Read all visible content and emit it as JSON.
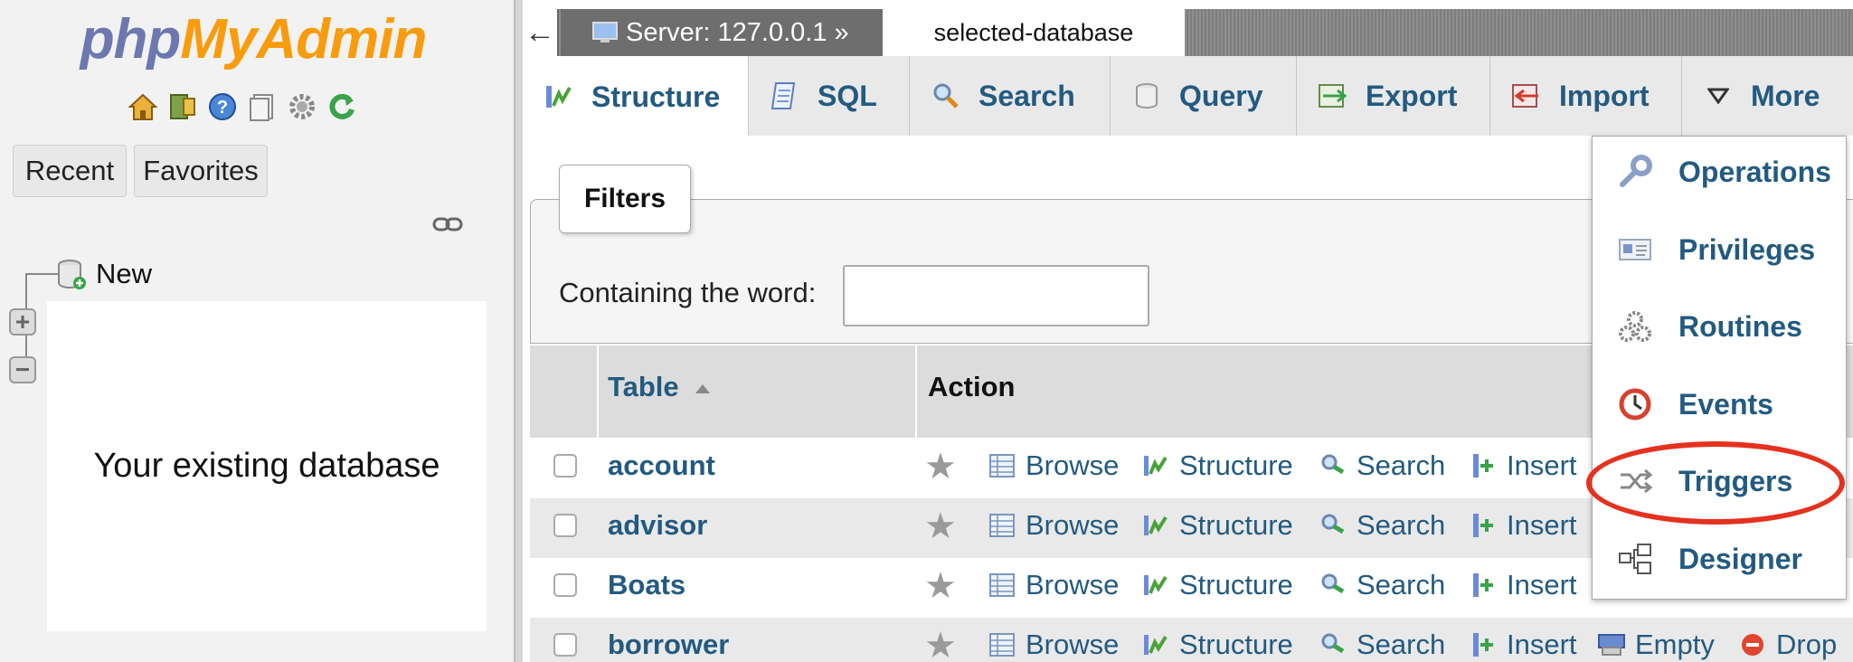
{
  "app": {
    "logo_php": "php",
    "logo_myadmin": "MyAdmin",
    "left_buttons": [
      "Recent",
      "Favorites"
    ],
    "tree_new_label": "New",
    "database_box_text": "Your existing database"
  },
  "breadcrumb": {
    "back": "←",
    "server": "Server: 127.0.0.1 »",
    "database": "selected-database"
  },
  "tabs": [
    {
      "label": "Structure",
      "icon": "structure-icon",
      "active": true
    },
    {
      "label": "SQL",
      "icon": "sql-icon"
    },
    {
      "label": "Search",
      "icon": "search-icon"
    },
    {
      "label": "Query",
      "icon": "query-icon"
    },
    {
      "label": "Export",
      "icon": "export-icon"
    },
    {
      "label": "Import",
      "icon": "import-icon"
    },
    {
      "label": "More",
      "icon": "caret-down-icon"
    }
  ],
  "filters": {
    "legend": "Filters",
    "label": "Containing the word:",
    "value": ""
  },
  "table_headers": {
    "table": "Table",
    "action": "Action"
  },
  "rows": [
    {
      "name": "account",
      "actions": [
        "Browse",
        "Structure",
        "Search",
        "Insert"
      ]
    },
    {
      "name": "advisor",
      "actions": [
        "Browse",
        "Structure",
        "Search",
        "Insert"
      ]
    },
    {
      "name": "Boats",
      "actions": [
        "Browse",
        "Structure",
        "Search",
        "Insert"
      ]
    },
    {
      "name": "borrower",
      "actions": [
        "Browse",
        "Structure",
        "Search",
        "Insert",
        "Empty",
        "Drop"
      ]
    }
  ],
  "more_menu": [
    {
      "label": "Operations",
      "icon": "wrench-icon"
    },
    {
      "label": "Privileges",
      "icon": "id-card-icon"
    },
    {
      "label": "Routines",
      "icon": "gears-icon"
    },
    {
      "label": "Events",
      "icon": "clock-icon"
    },
    {
      "label": "Triggers",
      "icon": "trigger-icon",
      "highlighted": true
    },
    {
      "label": "Designer",
      "icon": "designer-icon"
    }
  ],
  "colors": {
    "link": "#235a81",
    "highlight": "#e5311f",
    "logo_php": "#6c78af",
    "logo_myadmin": "#f89c0e"
  }
}
